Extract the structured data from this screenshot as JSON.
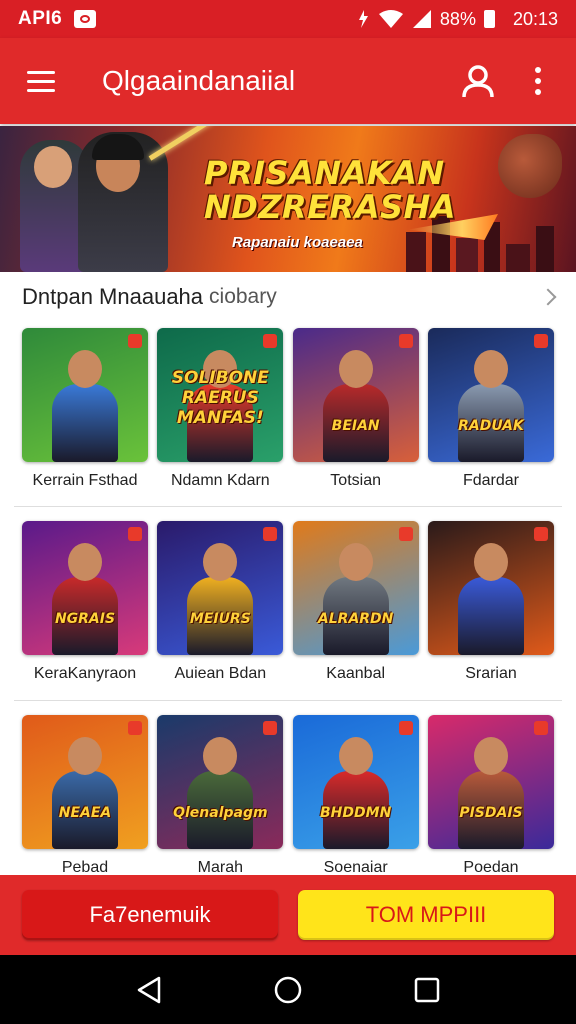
{
  "status_bar": {
    "carrier": "API6",
    "battery_percent": "88%",
    "time": "20:13",
    "icons": [
      "app-notification-icon",
      "signal-icon",
      "wifi-icon",
      "cell-signal-icon",
      "battery-icon"
    ]
  },
  "app_bar": {
    "title": "Qlgaaindanaiial",
    "icons": [
      "menu-icon",
      "user-icon",
      "more-vert-icon"
    ]
  },
  "banner": {
    "headline_line1": "PRISANAKAN",
    "headline_line2": "NDZRERASHA",
    "subtitle": "Rapanaiu koaeaea"
  },
  "section": {
    "title": "Dntpan Mnaauaha",
    "subtitle": "ciobary"
  },
  "games": [
    {
      "name": "Kerrain Fsthad",
      "logo": "",
      "colors": [
        "#2f8a3a",
        "#6ac23a"
      ],
      "accent": "#3a7ad8"
    },
    {
      "name": "Ndamn Kdarn",
      "logo": "SOLIBONE RAERUS MANFAS!",
      "colors": [
        "#0e6a4a",
        "#2aa06a"
      ],
      "accent": "#e83a2a"
    },
    {
      "name": "Totsian",
      "logo": "BEIAN",
      "colors": [
        "#4a2a8a",
        "#d8603a"
      ],
      "accent": "#b82a2a"
    },
    {
      "name": "Fdardar",
      "logo": "RADUAK",
      "colors": [
        "#1a2a5a",
        "#3a6ad8"
      ],
      "accent": "#8a9ab0"
    },
    {
      "name": "KeraKanyraon",
      "logo": "NGRAIS",
      "colors": [
        "#5a1a8a",
        "#d83a7a"
      ],
      "accent": "#c82a2a"
    },
    {
      "name": "Auiean Bdan",
      "logo": "MEIURS",
      "colors": [
        "#2a1a6a",
        "#3a5ad8"
      ],
      "accent": "#f0b020"
    },
    {
      "name": "Kaanbal",
      "logo": "ALRARDN",
      "colors": [
        "#e07a1a",
        "#4a9ad8"
      ],
      "accent": "#707880"
    },
    {
      "name": "Srarian",
      "logo": "",
      "colors": [
        "#2a1a1a",
        "#e05a1a"
      ],
      "accent": "#3a5ad8"
    },
    {
      "name": "Pebad",
      "logo": "NEAEA",
      "colors": [
        "#e05a1a",
        "#f0a020"
      ],
      "accent": "#3a6aa8"
    },
    {
      "name": "Marah",
      "logo": "Qlenalpagm",
      "colors": [
        "#1a3a6a",
        "#8a2a5a"
      ],
      "accent": "#4a6a3a"
    },
    {
      "name": "Soenaiar",
      "logo": "BHDDMN",
      "colors": [
        "#1a6ad8",
        "#3aa0e8"
      ],
      "accent": "#d82a2a"
    },
    {
      "name": "Poedan",
      "logo": "PISDAIS",
      "colors": [
        "#d82a6a",
        "#3a2a9a"
      ],
      "accent": "#b85a3a"
    }
  ],
  "actions": {
    "left_button": "Fa7enemuik",
    "right_button": "TOM MPPIII"
  },
  "nav": {
    "icons": [
      "back-icon",
      "home-icon",
      "recents-icon"
    ]
  }
}
